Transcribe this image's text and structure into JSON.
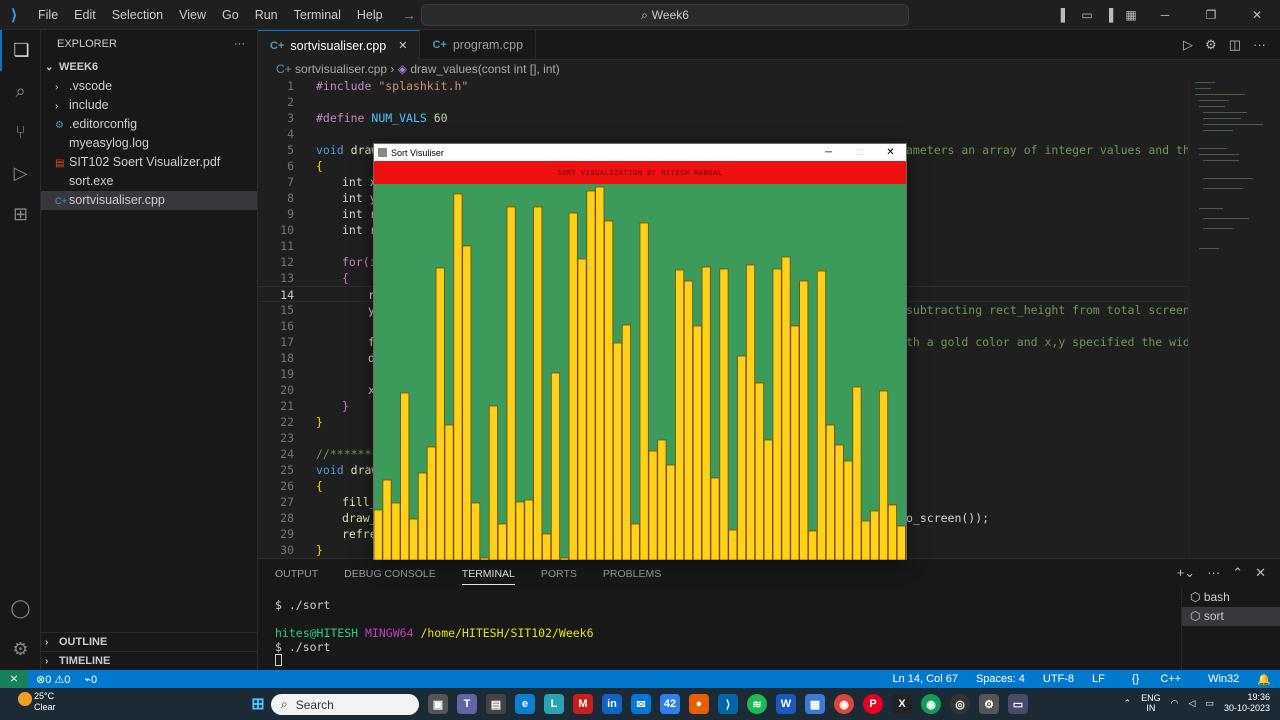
{
  "menu": [
    "File",
    "Edit",
    "Selection",
    "View",
    "Go",
    "Run",
    "Terminal",
    "Help"
  ],
  "command_center": "Week6",
  "explorer": {
    "title": "EXPLORER",
    "root": "WEEK6",
    "items": [
      {
        "label": ".vscode",
        "type": "folder"
      },
      {
        "label": "include",
        "type": "folder"
      },
      {
        "label": ".editorconfig",
        "type": "file"
      },
      {
        "label": "myeasylog.log",
        "type": "file"
      },
      {
        "label": "SIT102 Soert Visualizer.pdf",
        "type": "file"
      },
      {
        "label": "sort.exe",
        "type": "file"
      },
      {
        "label": "sortvisualiser.cpp",
        "type": "file",
        "selected": true
      }
    ],
    "outline": "OUTLINE",
    "timeline": "TIMELINE"
  },
  "tabs": [
    {
      "label": "sortvisualiser.cpp",
      "active": true
    },
    {
      "label": "program.cpp",
      "active": false
    }
  ],
  "breadcrumb": {
    "file": "sortvisualiser.cpp",
    "symbol": "draw_values(const int [], int)"
  },
  "code": {
    "line_numbers": [
      "1",
      "2",
      "3",
      "4",
      "5",
      "6",
      "7",
      "8",
      "9",
      "10",
      "11",
      "12",
      "13",
      "14",
      "15",
      "16",
      "17",
      "18",
      "19",
      "20",
      "21",
      "22",
      "23",
      "24",
      "25",
      "26",
      "27",
      "28",
      "29",
      "30"
    ],
    "l1_pp": "#include",
    "l1_str": "\"splashkit.h\"",
    "l3_pp": "#define",
    "l3_mac": "NUM_VALS",
    "l3_num": "60",
    "l5_kw": "void",
    "l5_fn": "draw",
    "l5_tail": "ameters an array of integer values and the",
    "l6": "{",
    "l7": "int x",
    "l8": "int y",
    "l9": "int r",
    "l10": "int r",
    "l12": "for(i",
    "l13": "{",
    "l14": "r",
    "l15": "y",
    "l15_tail": "subtracting rect_height from total screen",
    "l17": "f",
    "l17_tail": "th a gold color and x,y specified the width",
    "l18": "d",
    "l20": "x",
    "l21": "}",
    "l22": "}",
    "l24": "//*******",
    "l25_kw": "void",
    "l25_fn": "draw",
    "l26": "{",
    "l27": "fill_",
    "l28": "draw_",
    "l28_tail": "o_screen());",
    "l29": "refre",
    "l30": "}"
  },
  "panel": {
    "tabs": [
      "OUTPUT",
      "DEBUG CONSOLE",
      "TERMINAL",
      "PORTS",
      "PROBLEMS"
    ],
    "active_tab": "TERMINAL",
    "terminal_lines": {
      "l1": "$ ./sort",
      "user": "hites@HITESH",
      "env": "MINGW64",
      "path": "/home/HITESH/SIT102/Week6",
      "l3": "$ ./sort"
    },
    "terminals": [
      "bash",
      "sort"
    ]
  },
  "statusbar": {
    "errors": "0",
    "warnings": "0",
    "ports": "0",
    "position": "Ln 14, Col 67",
    "spaces": "Spaces: 4",
    "encoding": "UTF-8",
    "eol": "LF",
    "braces": "{}",
    "language": "C++",
    "platform": "Win32"
  },
  "sort_window": {
    "title": "Sort Visuliser",
    "banner": "SORT VISUALIZATION BY HITESH MANGAL",
    "bg_color": "#3c9a5a",
    "bar_color": "#ffd11a",
    "bar_max": 376,
    "values": [
      50,
      80,
      57,
      167,
      41,
      87,
      113,
      292,
      135,
      366,
      314,
      57,
      0,
      154,
      36,
      353,
      58,
      60,
      353,
      26,
      187,
      0,
      347,
      301,
      369,
      373,
      339,
      217,
      235,
      36,
      337,
      109,
      120,
      95,
      290,
      279,
      234,
      293,
      82,
      291,
      30,
      204,
      295,
      177,
      120,
      291,
      303,
      234,
      279,
      29,
      289,
      135,
      115,
      99,
      173,
      39,
      49,
      169,
      55,
      34
    ]
  },
  "taskbar": {
    "weather_temp": "25°C",
    "weather_desc": "Clear",
    "search_placeholder": "Search",
    "lang": "ENG",
    "region": "IN",
    "time": "19:36",
    "date": "30-10-2023"
  }
}
